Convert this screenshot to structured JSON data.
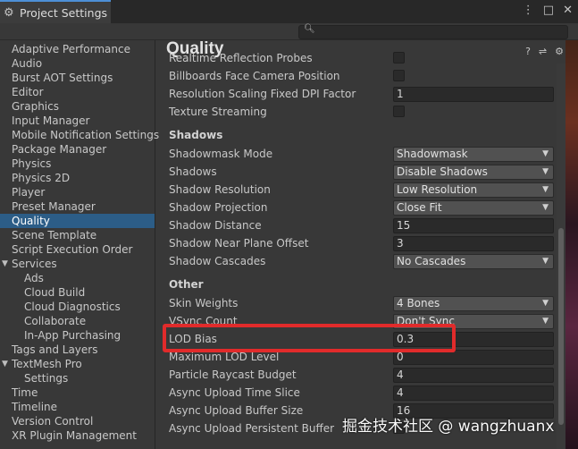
{
  "window": {
    "tab_title": "Project Settings",
    "tab_icon": "gear-icon",
    "controls": [
      "⋮",
      "□",
      "✕"
    ]
  },
  "search": {
    "placeholder": "",
    "icon": "search-icon"
  },
  "sidebar": {
    "items": [
      {
        "label": "Adaptive Performance",
        "indent": 0
      },
      {
        "label": "Audio",
        "indent": 0
      },
      {
        "label": "Burst AOT Settings",
        "indent": 0
      },
      {
        "label": "Editor",
        "indent": 0
      },
      {
        "label": "Graphics",
        "indent": 0
      },
      {
        "label": "Input Manager",
        "indent": 0
      },
      {
        "label": "Mobile Notification Settings",
        "indent": 0
      },
      {
        "label": "Package Manager",
        "indent": 0
      },
      {
        "label": "Physics",
        "indent": 0
      },
      {
        "label": "Physics 2D",
        "indent": 0
      },
      {
        "label": "Player",
        "indent": 0
      },
      {
        "label": "Preset Manager",
        "indent": 0
      },
      {
        "label": "Quality",
        "indent": 0,
        "selected": true
      },
      {
        "label": "Scene Template",
        "indent": 0
      },
      {
        "label": "Script Execution Order",
        "indent": 0
      },
      {
        "label": "Services",
        "indent": 0,
        "expanded": true
      },
      {
        "label": "Ads",
        "indent": 1
      },
      {
        "label": "Cloud Build",
        "indent": 1
      },
      {
        "label": "Cloud Diagnostics",
        "indent": 1
      },
      {
        "label": "Collaborate",
        "indent": 1
      },
      {
        "label": "In-App Purchasing",
        "indent": 1
      },
      {
        "label": "Tags and Layers",
        "indent": 0
      },
      {
        "label": "TextMesh Pro",
        "indent": 0,
        "expanded": true
      },
      {
        "label": "Settings",
        "indent": 1
      },
      {
        "label": "Time",
        "indent": 0
      },
      {
        "label": "Timeline",
        "indent": 0
      },
      {
        "label": "Version Control",
        "indent": 0
      },
      {
        "label": "XR Plugin Management",
        "indent": 0
      }
    ]
  },
  "main": {
    "title": "Quality",
    "header_icons": [
      "help-icon",
      "presets-icon",
      "settings-icon"
    ],
    "rows": [
      {
        "kind": "row",
        "label": "Realtime Reflection Probes",
        "control": "checkbox"
      },
      {
        "kind": "row",
        "label": "Billboards Face Camera Position",
        "control": "checkbox"
      },
      {
        "kind": "row",
        "label": "Resolution Scaling Fixed DPI Factor",
        "control": "field",
        "value": "1"
      },
      {
        "kind": "row",
        "label": "Texture Streaming",
        "control": "checkbox"
      },
      {
        "kind": "section",
        "label": "Shadows"
      },
      {
        "kind": "row",
        "label": "Shadowmask Mode",
        "control": "dropdown",
        "value": "Shadowmask"
      },
      {
        "kind": "row",
        "label": "Shadows",
        "control": "dropdown",
        "value": "Disable Shadows"
      },
      {
        "kind": "row",
        "label": "Shadow Resolution",
        "control": "dropdown",
        "value": "Low Resolution"
      },
      {
        "kind": "row",
        "label": "Shadow Projection",
        "control": "dropdown",
        "value": "Close Fit"
      },
      {
        "kind": "row",
        "label": "Shadow Distance",
        "control": "field",
        "value": "15"
      },
      {
        "kind": "row",
        "label": "Shadow Near Plane Offset",
        "control": "field",
        "value": "3"
      },
      {
        "kind": "row",
        "label": "Shadow Cascades",
        "control": "dropdown",
        "value": "No Cascades"
      },
      {
        "kind": "section",
        "label": "Other"
      },
      {
        "kind": "row",
        "label": "Skin Weights",
        "control": "dropdown",
        "value": "4 Bones"
      },
      {
        "kind": "row",
        "label": "VSync Count",
        "control": "dropdown",
        "value": "Don't Sync"
      },
      {
        "kind": "row",
        "label": "LOD Bias",
        "control": "field",
        "value": "0.3",
        "highlighted": true
      },
      {
        "kind": "row",
        "label": "Maximum LOD Level",
        "control": "field",
        "value": "0"
      },
      {
        "kind": "row",
        "label": "Particle Raycast Budget",
        "control": "field",
        "value": "4"
      },
      {
        "kind": "row",
        "label": "Async Upload Time Slice",
        "control": "field",
        "value": "4"
      },
      {
        "kind": "row",
        "label": "Async Upload Buffer Size",
        "control": "field",
        "value": "16"
      },
      {
        "kind": "row",
        "label": "Async Upload Persistent Buffer",
        "control": "checkbox"
      }
    ]
  },
  "watermark": "掘金技术社区 @ wangzhuanx",
  "colors": {
    "selection": "#2c5d87",
    "annotation": "#e12b2b",
    "tab_accent": "#4d8fd6"
  }
}
